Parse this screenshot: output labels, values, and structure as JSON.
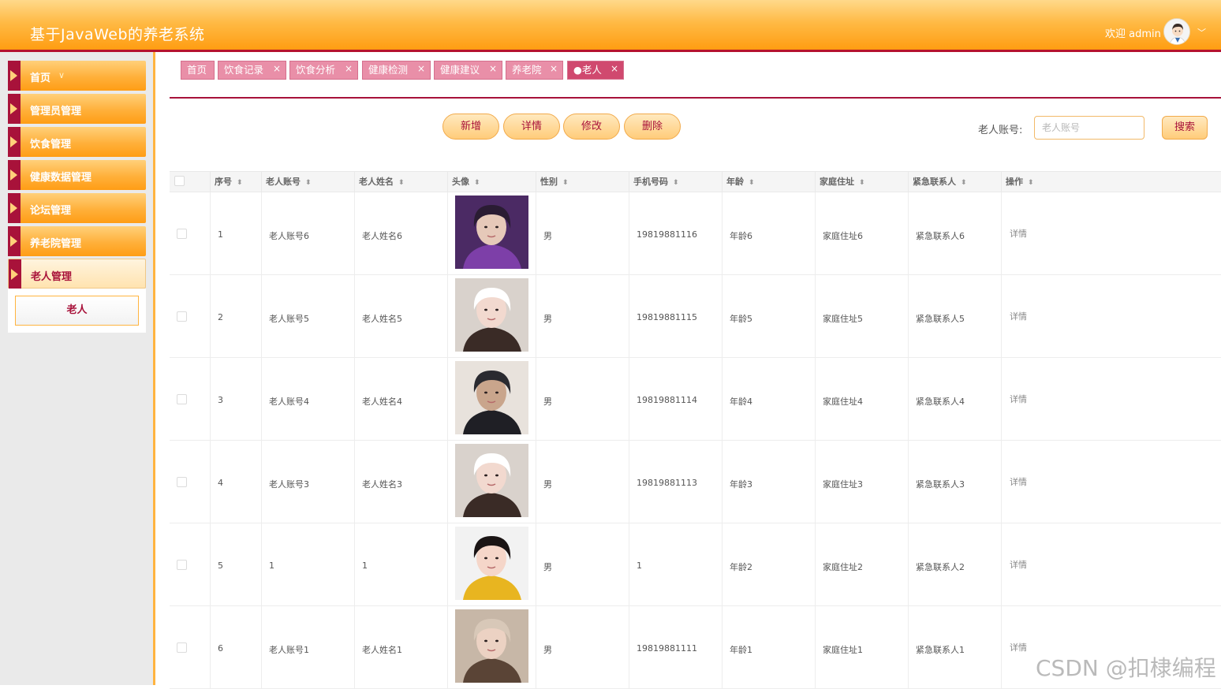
{
  "header": {
    "title": "基于JavaWeb的养老系统",
    "welcome": "欢迎 admin",
    "avatar_icon": "user-avatar-icon",
    "dropdown_icon": "chevron-down-icon"
  },
  "sidebar": {
    "items": [
      {
        "label": "首页",
        "chevron": "∨"
      },
      {
        "label": "管理员管理"
      },
      {
        "label": "饮食管理"
      },
      {
        "label": "健康数据管理"
      },
      {
        "label": "论坛管理"
      },
      {
        "label": "养老院管理"
      },
      {
        "label": "老人管理"
      }
    ],
    "submenu": {
      "label": "老人"
    }
  },
  "tabs": [
    {
      "label": "首页",
      "closable": false
    },
    {
      "label": "饮食记录",
      "closable": true
    },
    {
      "label": "饮食分析",
      "closable": true
    },
    {
      "label": "健康检测",
      "closable": true
    },
    {
      "label": "健康建议",
      "closable": true
    },
    {
      "label": "养老院",
      "closable": true
    },
    {
      "label": "●老人",
      "closable": true
    }
  ],
  "close_glyph": "×",
  "actions": {
    "add": "新增",
    "detail": "详情",
    "edit": "修改",
    "delete": "删除"
  },
  "search": {
    "label": "老人账号:",
    "placeholder": "老人账号",
    "button": "搜索"
  },
  "table": {
    "columns": [
      "序号",
      "老人账号",
      "老人姓名",
      "头像",
      "性别",
      "手机号码",
      "年龄",
      "家庭住址",
      "紧急联系人",
      "操作"
    ],
    "sort_glyph": "⬍",
    "rows": [
      {
        "index": "1",
        "account": "老人账号6",
        "name": "老人姓名6",
        "gender": "男",
        "phone": "19819881116",
        "age": "年龄6",
        "address": "家庭住址6",
        "contact": "紧急联系人6",
        "op": "详情"
      },
      {
        "index": "2",
        "account": "老人账号5",
        "name": "老人姓名5",
        "gender": "男",
        "phone": "19819881115",
        "age": "年龄5",
        "address": "家庭住址5",
        "contact": "紧急联系人5",
        "op": "详情"
      },
      {
        "index": "3",
        "account": "老人账号4",
        "name": "老人姓名4",
        "gender": "男",
        "phone": "19819881114",
        "age": "年龄4",
        "address": "家庭住址4",
        "contact": "紧急联系人4",
        "op": "详情"
      },
      {
        "index": "4",
        "account": "老人账号3",
        "name": "老人姓名3",
        "gender": "男",
        "phone": "19819881113",
        "age": "年龄3",
        "address": "家庭住址3",
        "contact": "紧急联系人3",
        "op": "详情"
      },
      {
        "index": "5",
        "account": "1",
        "name": "1",
        "gender": "男",
        "phone": "1",
        "age": "年龄2",
        "address": "家庭住址2",
        "contact": "紧急联系人2",
        "op": "详情"
      },
      {
        "index": "6",
        "account": "老人账号1",
        "name": "老人姓名1",
        "gender": "男",
        "phone": "19819881111",
        "age": "年龄1",
        "address": "家庭住址1",
        "contact": "紧急联系人1",
        "op": "详情"
      }
    ]
  },
  "watermark": "CSDN @扣棣编程",
  "colors": {
    "accent": "#ff9d12",
    "brand_dark": "#a8123a",
    "tab_pink": "#e98fa8",
    "sidebar_bg": "#eaeaea"
  }
}
